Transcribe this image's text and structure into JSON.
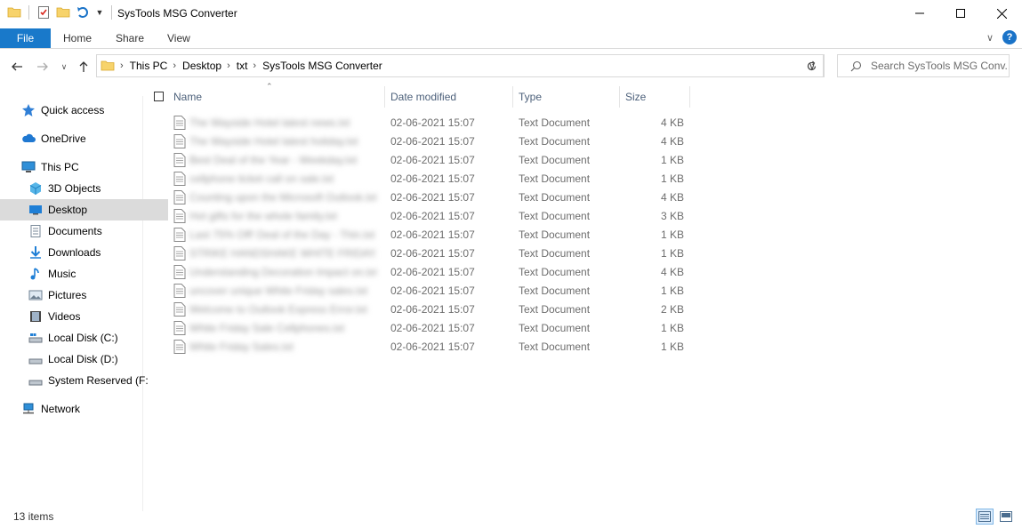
{
  "window": {
    "title": "SysTools MSG Converter",
    "controls": [
      "minimize",
      "maximize",
      "close"
    ]
  },
  "ribbon": {
    "file_tab": "File",
    "tabs": [
      "Home",
      "Share",
      "View"
    ]
  },
  "address": {
    "breadcrumbs": [
      "This PC",
      "Desktop",
      "txt",
      "SysTools MSG Converter"
    ]
  },
  "search": {
    "placeholder": "Search SysTools MSG Conv..."
  },
  "sidebar": {
    "items": [
      {
        "label": "Quick access",
        "icon": "star-icon"
      },
      {
        "label": "OneDrive",
        "icon": "cloud-icon"
      },
      {
        "label": "This PC",
        "icon": "computer-icon"
      },
      {
        "label": "3D Objects",
        "icon": "cube-icon"
      },
      {
        "label": "Desktop",
        "icon": "desktop-icon",
        "selected": true
      },
      {
        "label": "Documents",
        "icon": "documents-icon"
      },
      {
        "label": "Downloads",
        "icon": "download-icon"
      },
      {
        "label": "Music",
        "icon": "music-icon"
      },
      {
        "label": "Pictures",
        "icon": "pictures-icon"
      },
      {
        "label": "Videos",
        "icon": "videos-icon"
      },
      {
        "label": "Local Disk (C:)",
        "icon": "drive-icon"
      },
      {
        "label": "Local Disk (D:)",
        "icon": "drive-icon"
      },
      {
        "label": "System Reserved (F:",
        "icon": "drive-icon"
      },
      {
        "label": "Network",
        "icon": "network-icon"
      }
    ]
  },
  "columns": {
    "name": "Name",
    "date": "Date modified",
    "type": "Type",
    "size": "Size"
  },
  "files": [
    {
      "name": "The Wayside Hotel latest news.txt",
      "date": "02-06-2021 15:07",
      "type": "Text Document",
      "size": "4 KB"
    },
    {
      "name": "The Wayside Hotel latest holiday.txt",
      "date": "02-06-2021 15:07",
      "type": "Text Document",
      "size": "4 KB"
    },
    {
      "name": "Best Deal of the Year - Weekday.txt",
      "date": "02-06-2021 15:07",
      "type": "Text Document",
      "size": "1 KB"
    },
    {
      "name": "cellphone ticket call on sale.txt",
      "date": "02-06-2021 15:07",
      "type": "Text Document",
      "size": "1 KB"
    },
    {
      "name": "Counting upon the Microsoft Outlook.txt",
      "date": "02-06-2021 15:07",
      "type": "Text Document",
      "size": "4 KB"
    },
    {
      "name": "Hot gifts for the whole family.txt",
      "date": "02-06-2021 15:07",
      "type": "Text Document",
      "size": "3 KB"
    },
    {
      "name": "Last 75% Off! Deal of the Day - Thin.txt",
      "date": "02-06-2021 15:07",
      "type": "Text Document",
      "size": "1 KB"
    },
    {
      "name": "STRIKE HANDSHAKE WHITE FRIDAY.txt",
      "date": "02-06-2021 15:07",
      "type": "Text Document",
      "size": "1 KB"
    },
    {
      "name": "Understanding Decoration Impact on.txt",
      "date": "02-06-2021 15:07",
      "type": "Text Document",
      "size": "4 KB"
    },
    {
      "name": "uncover unique White Friday sales.txt",
      "date": "02-06-2021 15:07",
      "type": "Text Document",
      "size": "1 KB"
    },
    {
      "name": "Welcome to Outlook Express Error.txt",
      "date": "02-06-2021 15:07",
      "type": "Text Document",
      "size": "2 KB"
    },
    {
      "name": "White Friday Sale Cellphones.txt",
      "date": "02-06-2021 15:07",
      "type": "Text Document",
      "size": "1 KB"
    },
    {
      "name": "White Friday Sales.txt",
      "date": "02-06-2021 15:07",
      "type": "Text Document",
      "size": "1 KB"
    }
  ],
  "status": {
    "count": "13 items"
  },
  "colors": {
    "file_tab": "#1979ca",
    "selected_nav": "#dbdbdb",
    "column_header_text": "#4c607a",
    "row_text": "#6d6d6d"
  }
}
